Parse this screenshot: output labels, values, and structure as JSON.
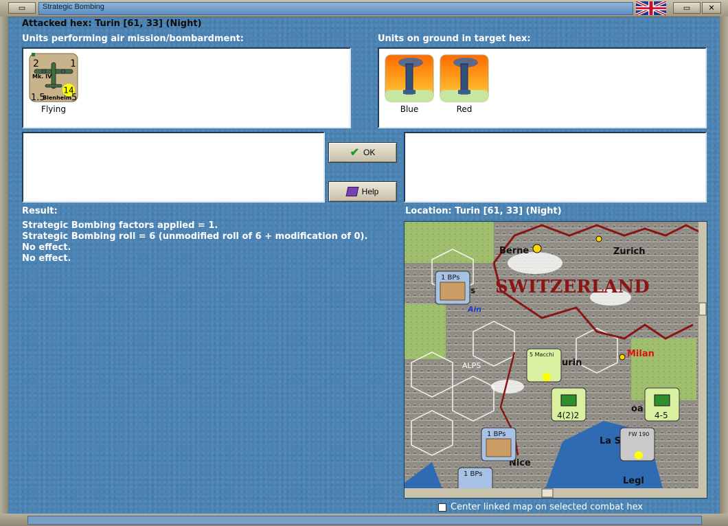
{
  "window": {
    "title": "Strategic Bombing",
    "close_glyph": "✕"
  },
  "header": {
    "attacked_hex": "Attacked hex: Turin  [61, 33] (Night)"
  },
  "air_units": {
    "heading": "Units performing air mission/bombardment:",
    "items": [
      {
        "counter_top_left": "2",
        "counter_top_right": "1",
        "counter_type": "Mk. IV",
        "counter_bottom_left": "1.5",
        "counter_bottom_right": "5",
        "counter_circle": "14",
        "counter_name": "Blenheim",
        "status": "Flying"
      }
    ]
  },
  "ground_units": {
    "heading": "Units on ground in target hex:",
    "items": [
      {
        "label": "Blue",
        "icon": "factory-smokestack-icon"
      },
      {
        "label": "Red",
        "icon": "factory-smokestack-icon"
      }
    ]
  },
  "buttons": {
    "ok_label": "OK",
    "help_label": "Help"
  },
  "result": {
    "heading": "Result:",
    "lines": [
      "Strategic Bombing factors applied = 1.",
      "Strategic Bombing roll = 6 (unmodified roll of 6 + modification of 0).",
      "No effect.",
      "No effect."
    ]
  },
  "location": {
    "heading": "Location:  Turin  [61, 33] (Night)"
  },
  "map": {
    "labels": {
      "country": "SWITZERLAND",
      "berne": "Berne",
      "zurich": "Zurich",
      "milan": "Milan",
      "turin": "urin",
      "alps": "ALPS",
      "ain": "Ain",
      "nice": "Nice",
      "las": "La S",
      "leg": "Legl",
      "oa": "oa",
      "s": "s"
    },
    "counters": [
      {
        "text": "1 BPs"
      },
      {
        "text": "1 BPs"
      },
      {
        "text": "1 BPs"
      },
      {
        "text": "5 Macchi"
      },
      {
        "text": "4(2)2"
      },
      {
        "text": "4-5"
      },
      {
        "text": "FW 190"
      }
    ]
  },
  "footer": {
    "checkbox_label": "Center linked map on selected combat hex"
  }
}
